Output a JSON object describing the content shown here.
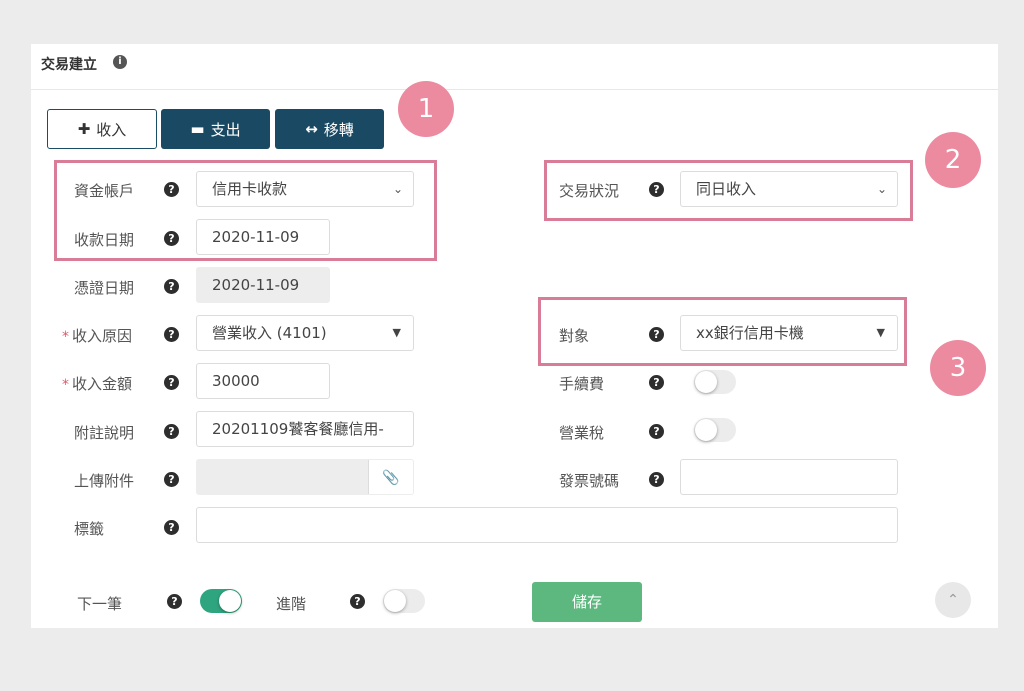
{
  "header": {
    "title": "交易建立",
    "info_icon": "i"
  },
  "tabs": [
    {
      "icon": "✚",
      "label": "收入"
    },
    {
      "icon": "▬",
      "label": "支出"
    },
    {
      "icon": "↔",
      "label": "移轉"
    }
  ],
  "help_icon": "?",
  "left_form": {
    "account": {
      "label": "資金帳戶",
      "value": "信用卡收款"
    },
    "receipt_date": {
      "label": "收款日期",
      "value": "2020-11-09"
    },
    "voucher_date": {
      "label": "憑證日期",
      "value": "2020-11-09"
    },
    "income_reason": {
      "label": "收入原因",
      "value": "營業收入 (4101)"
    },
    "income_amount": {
      "label": "收入金額",
      "value": "30000"
    },
    "note": {
      "label": "附註說明",
      "value": "20201109饕客餐廳信用-"
    },
    "attachment": {
      "label": "上傳附件"
    },
    "tags": {
      "label": "標籤",
      "value": ""
    }
  },
  "right_form": {
    "status": {
      "label": "交易狀況",
      "value": "同日收入"
    },
    "party": {
      "label": "對象",
      "value": "xx銀行信用卡機"
    },
    "fee": {
      "label": "手續費",
      "on": false
    },
    "business_tax": {
      "label": "營業稅",
      "on": false
    },
    "invoice_no": {
      "label": "發票號碼",
      "value": ""
    }
  },
  "required_mark": "*",
  "footer": {
    "next_label": "下一筆",
    "next_on": true,
    "advanced_label": "進階",
    "advanced_on": false,
    "save_label": "儲存"
  },
  "annotations": [
    "1",
    "2",
    "3"
  ],
  "colors": {
    "primary": "#1a4a63",
    "success": "#5db87f",
    "toggle_on": "#2fa57f",
    "highlight": "#d97c97",
    "badge": "#ec8a9f"
  }
}
